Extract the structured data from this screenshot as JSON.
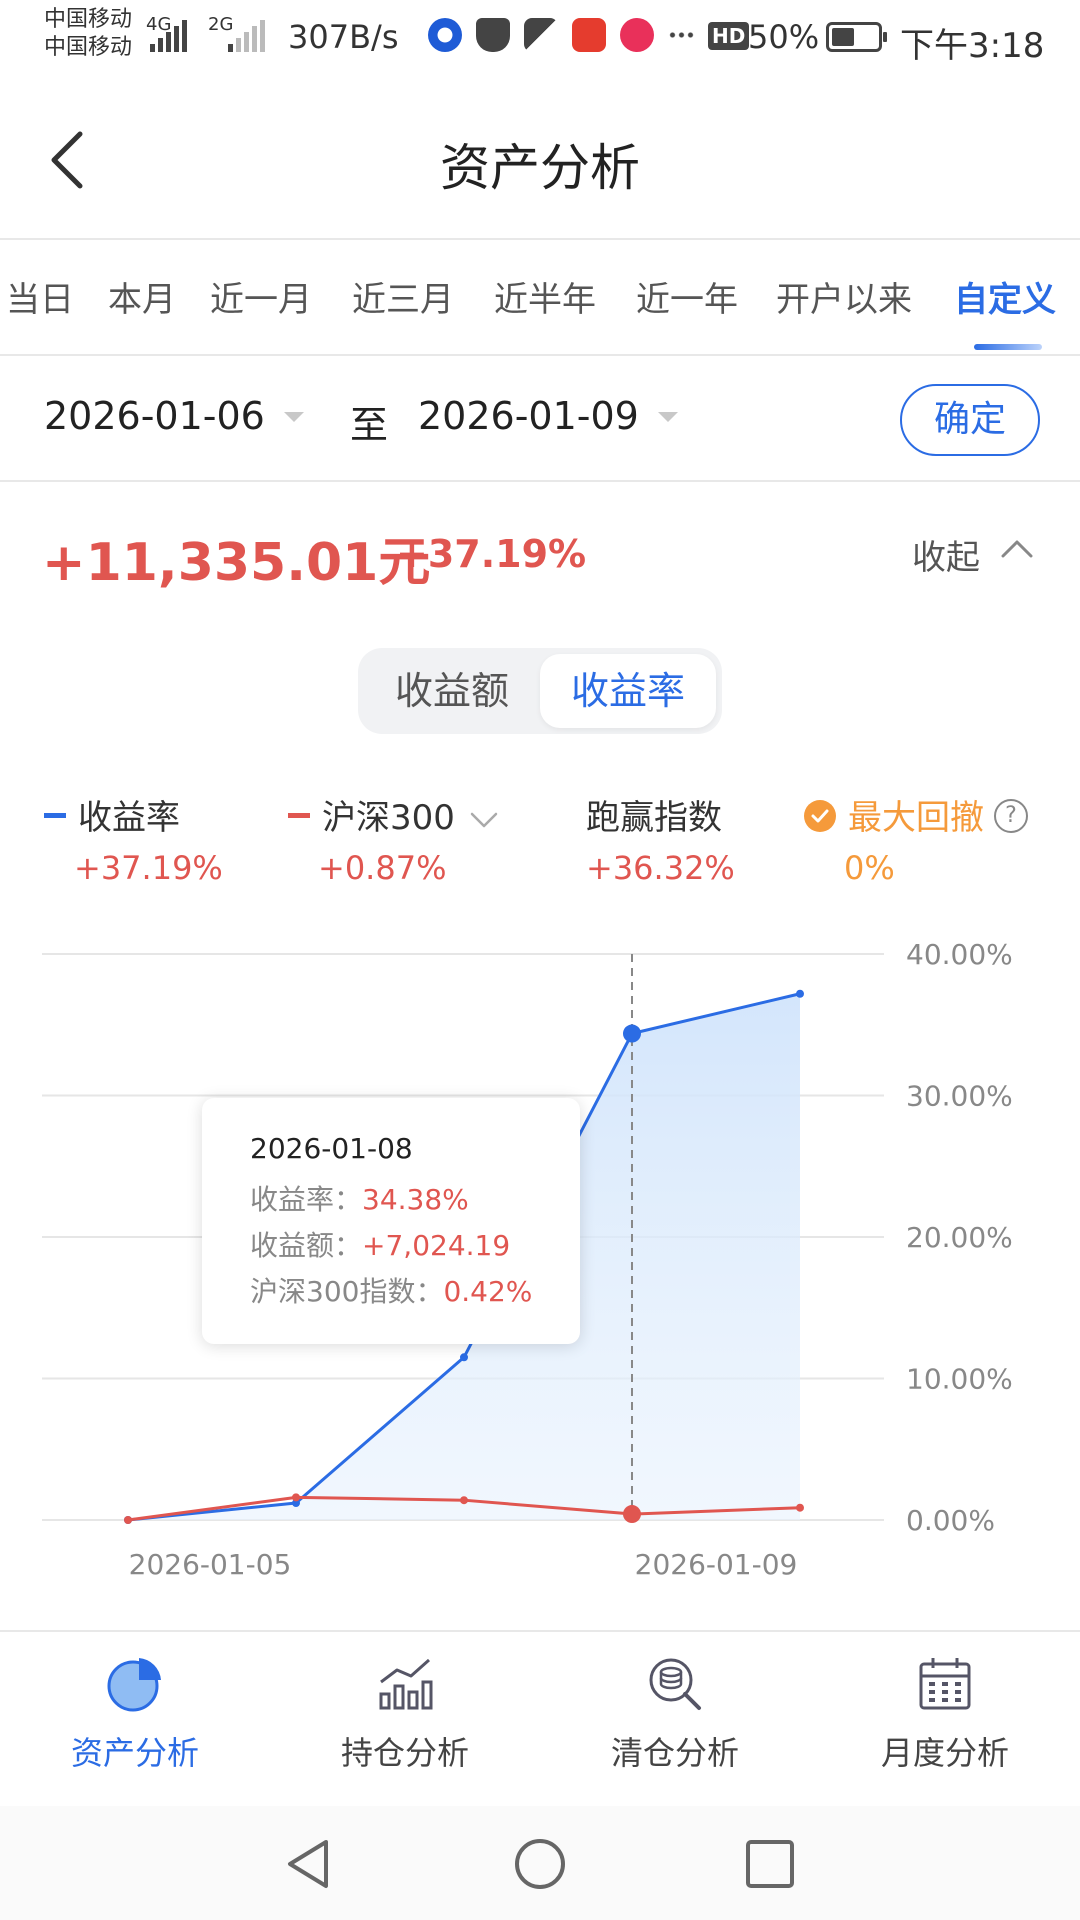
{
  "status_bar": {
    "carrier1": "中国移动",
    "carrier2": "中国移动",
    "net1": "4G",
    "net2": "2G",
    "speed": "307B/s",
    "hd": "HD",
    "battery": "50%",
    "time": "下午3:18"
  },
  "header": {
    "title": "资产分析"
  },
  "tabs": [
    {
      "label": "当日"
    },
    {
      "label": "本月"
    },
    {
      "label": "近一月"
    },
    {
      "label": "近三月"
    },
    {
      "label": "近半年"
    },
    {
      "label": "近一年"
    },
    {
      "label": "开户以来"
    },
    {
      "label": "自定义",
      "active": true
    }
  ],
  "date_range": {
    "start": "2026-01-06",
    "to_label": "至",
    "end": "2026-01-09",
    "confirm_label": "确定"
  },
  "summary": {
    "amount": "+11,335.01元",
    "rate": "+37.19%",
    "collapse_label": "收起"
  },
  "toggle": {
    "option_amount": "收益额",
    "option_rate": "收益率",
    "selected": "收益率"
  },
  "legend": [
    {
      "name": "收益率",
      "value": "+37.19%",
      "color": "#2b6ce4"
    },
    {
      "name": "沪深300",
      "value": "+0.87%",
      "color": "#e05650"
    },
    {
      "name": "跑赢指数",
      "value": "+36.32%",
      "color": "#e05650"
    },
    {
      "name": "最大回撤",
      "value": "0%",
      "color": "#f59a3b"
    }
  ],
  "chart_data": {
    "type": "line",
    "x": [
      "2026-01-05",
      "2026-01-06",
      "2026-01-07",
      "2026-01-08",
      "2026-01-09"
    ],
    "x_tick_labels": [
      "2026-01-05",
      "2026-01-09"
    ],
    "y_tick_labels": [
      "40.00%",
      "30.00%",
      "20.00%",
      "10.00%",
      "0.00%"
    ],
    "ylim": [
      0,
      40
    ],
    "series": [
      {
        "name": "收益率",
        "values": [
          0.0,
          1.2,
          11.5,
          34.38,
          37.19
        ],
        "color": "#2b6ce4",
        "area": true
      },
      {
        "name": "沪深300",
        "values": [
          0.0,
          1.6,
          1.4,
          0.42,
          0.87
        ],
        "color": "#e05650"
      }
    ],
    "highlight_index": 3,
    "grid": true
  },
  "tooltip": {
    "date": "2026-01-08",
    "rate_label": "收益率：",
    "rate_value": "34.38%",
    "amount_label": "收益额：",
    "amount_value": "+7,024.19",
    "index_label": "沪深300指数：",
    "index_value": "0.42%"
  },
  "bottom_nav": [
    {
      "label": "资产分析",
      "icon": "pie-chart-icon",
      "active": true
    },
    {
      "label": "持仓分析",
      "icon": "bar-trend-icon"
    },
    {
      "label": "清仓分析",
      "icon": "coin-search-icon"
    },
    {
      "label": "月度分析",
      "icon": "calendar-icon"
    }
  ],
  "colors": {
    "accent": "#2b6ce4",
    "gain": "#e05650",
    "warning": "#f59a3b"
  }
}
